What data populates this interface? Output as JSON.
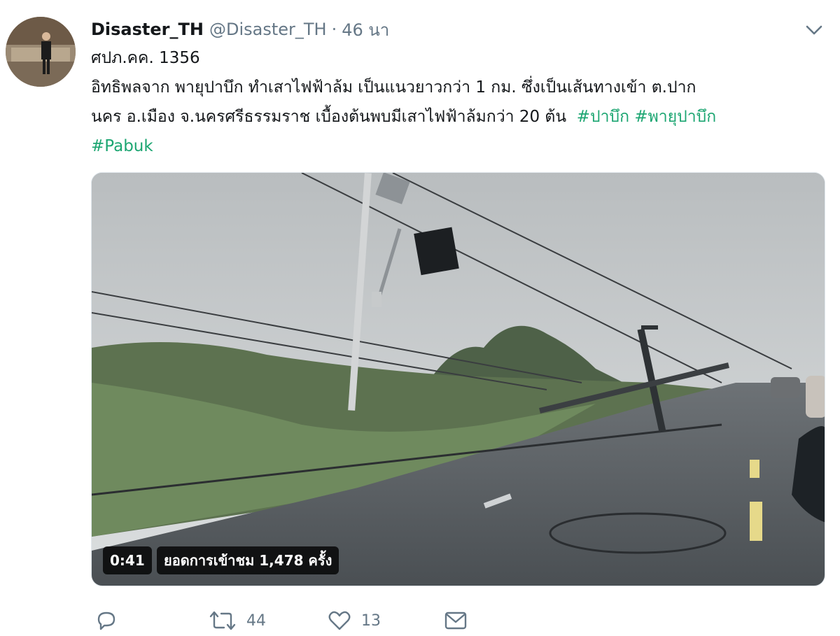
{
  "tweet": {
    "display_name": "Disaster_TH",
    "handle": "@Disaster_TH",
    "separator": "·",
    "time": "46 นา",
    "text_lines": [
      "ศปภ.คค. 1356",
      "อิทธิพลจาก พายุปาบึก ทำเสาไฟฟ้าล้ม เป็นแนวยาวกว่า 1 กม. ซึ่งเป็นเส้นทางเข้า ต.ปาก",
      "นคร อ.เมือง จ.นครศรีธรรมราช เบื้องต้นพบมีเสาไฟฟ้าล้มกว่า 20 ต้น"
    ],
    "hashtags": [
      "#ปาบึก",
      "#พายุปาบึก",
      "#Pabuk"
    ]
  },
  "video": {
    "duration": "0:41",
    "views": "ยอดการเข้าชม 1,478 ครั้ง"
  },
  "actions": {
    "reply_count": "",
    "retweet_count": "44",
    "like_count": "13"
  },
  "icons": [
    "avatar",
    "chevron-down-icon",
    "reply-icon",
    "retweet-icon",
    "like-icon",
    "dm-icon"
  ],
  "colors": {
    "hashtag": "#1da672",
    "muted": "#657786"
  }
}
